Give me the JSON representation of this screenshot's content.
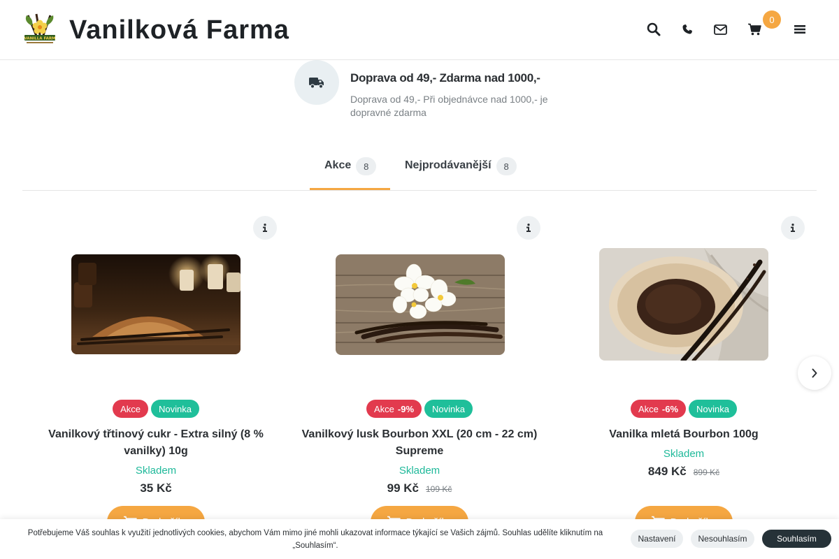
{
  "header": {
    "brand": "Vanilková Farma",
    "logo_text": "VANILLA FARM",
    "cart_count": "0",
    "icons": [
      "search-icon",
      "phone-icon",
      "envelope-icon",
      "cart-icon",
      "menu-icon"
    ]
  },
  "shipping": {
    "icon": "truck-icon",
    "title": "Doprava od 49,- Zdarma nad 1000,-",
    "description": "Doprava od 49,- Při objednávce nad 1000,- je dopravné zdarma"
  },
  "tabs": [
    {
      "label": "Akce",
      "count": "8",
      "active": true
    },
    {
      "label": "Nejprodávanější",
      "count": "8",
      "active": false
    }
  ],
  "products": [
    {
      "badge_sale": "Akce",
      "discount": "",
      "badge_new": "Novinka",
      "name": "Vanilkový třtinový cukr - Extra silný (8 % vanilky) 10g",
      "stock": "Skladem",
      "price": "35 Kč",
      "old_price": "",
      "add_to_cart": "Do košíku"
    },
    {
      "badge_sale": "Akce",
      "discount": "-9%",
      "badge_new": "Novinka",
      "name": "Vanilkový lusk Bourbon XXL (20 cm - 22 cm) Supreme",
      "stock": "Skladem",
      "price": "99 Kč",
      "old_price": "109 Kč",
      "add_to_cart": "Do košíku"
    },
    {
      "badge_sale": "Akce",
      "discount": "-6%",
      "badge_new": "Novinka",
      "name": "Vanilka mletá Bourbon 100g",
      "stock": "Skladem",
      "price": "849 Kč",
      "old_price": "899 Kč",
      "add_to_cart": "Do košíku"
    }
  ],
  "cookie": {
    "text": "Potřebujeme Váš souhlas k využití jednotlivých cookies, abychom Vám mimo jiné mohli ukazovat informace týkající se Vašich zájmů. Souhlas udělíte kliknutím na „Souhlasím“.",
    "settings": "Nastavení",
    "decline": "Nesouhlasím",
    "accept": "Souhlasím"
  },
  "colors": {
    "accent": "#f5a742",
    "sale": "#e23a4e",
    "new": "#1fbf9a",
    "stock": "#1fb99a",
    "dark_button": "#263238"
  }
}
